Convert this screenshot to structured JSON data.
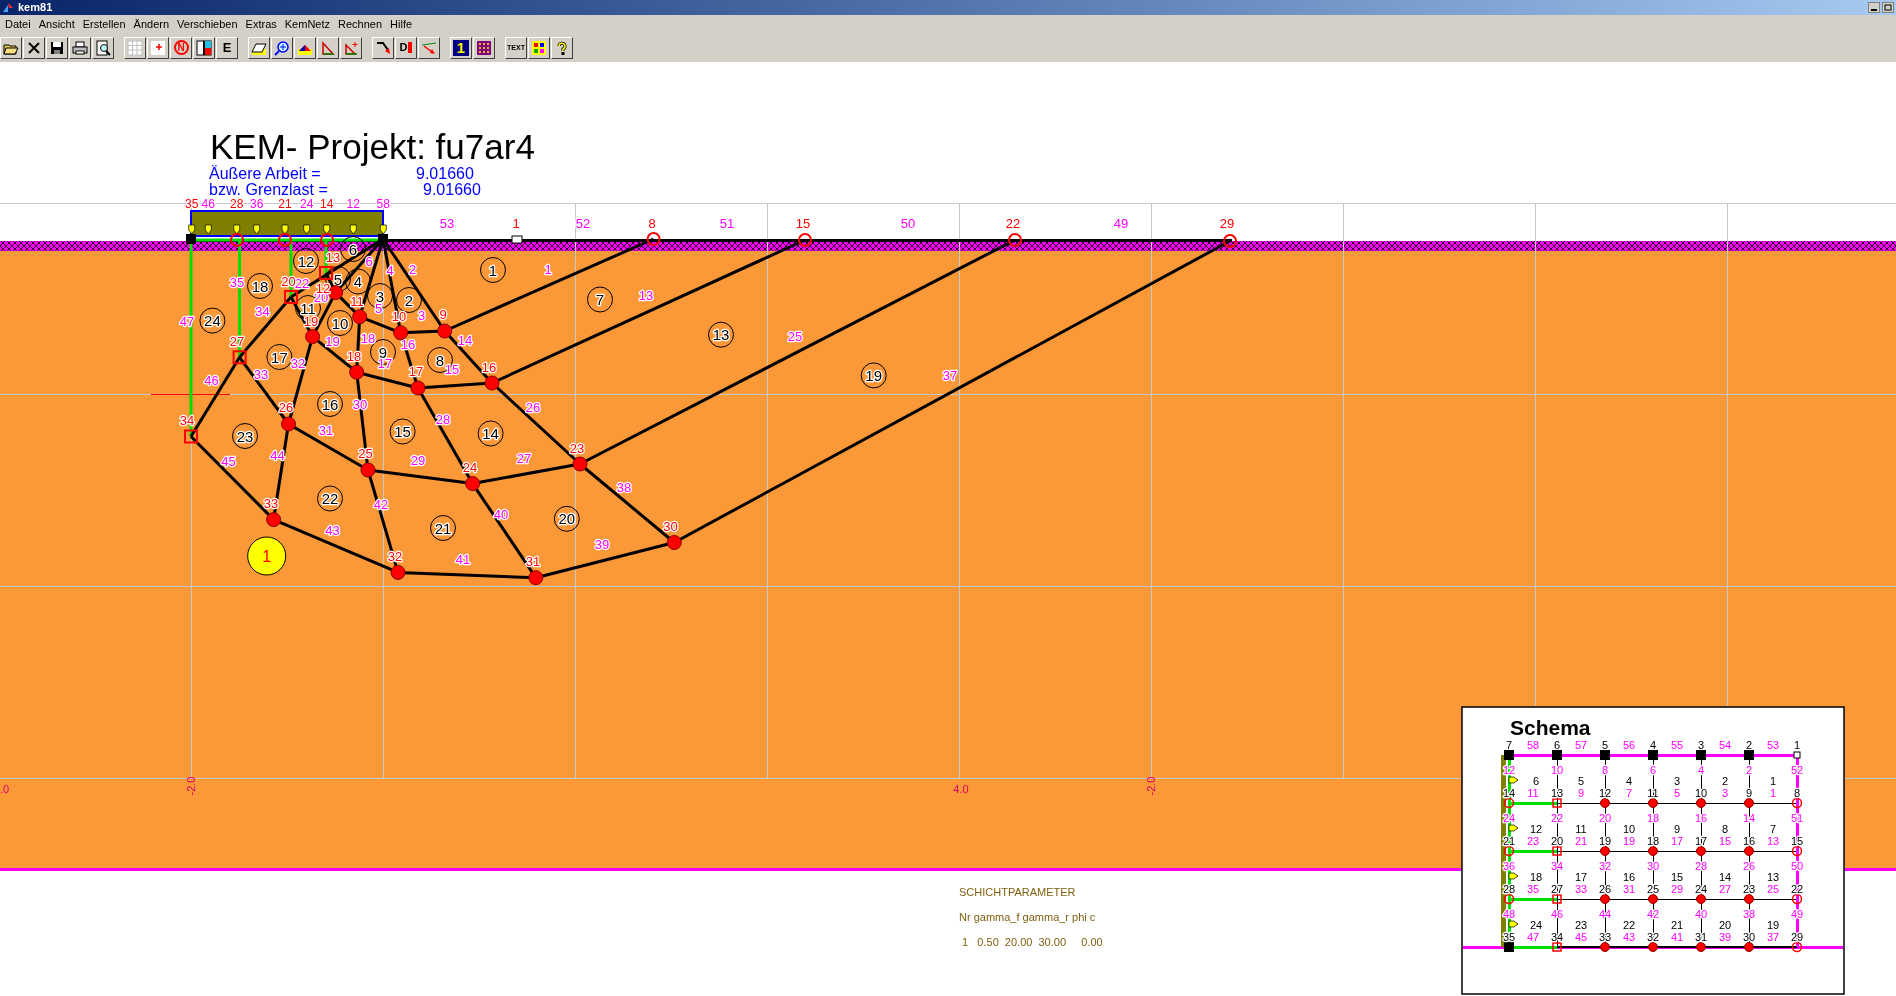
{
  "window": {
    "title": "kem81"
  },
  "menu": [
    "Datei",
    "Ansicht",
    "Erstellen",
    "Ändern",
    "Verschieben",
    "Extras",
    "KemNetz",
    "Rechnen",
    "Hilfe"
  ],
  "toolbar": [
    {
      "kind": "open"
    },
    {
      "kind": "close"
    },
    {
      "kind": "save"
    },
    {
      "kind": "print"
    },
    {
      "kind": "preview"
    },
    {
      "kind": "separator"
    },
    {
      "kind": "grid"
    },
    {
      "kind": "point"
    },
    {
      "kind": "no-sign",
      "label": "N"
    },
    {
      "kind": "split"
    },
    {
      "kind": "letter",
      "label": "E"
    },
    {
      "kind": "separator"
    },
    {
      "kind": "parallelogram"
    },
    {
      "kind": "zoom"
    },
    {
      "kind": "wedge"
    },
    {
      "kind": "triangle"
    },
    {
      "kind": "triangle-star"
    },
    {
      "kind": "separator"
    },
    {
      "kind": "arrow"
    },
    {
      "kind": "d-node",
      "label": "D"
    },
    {
      "kind": "line-arrow"
    },
    {
      "kind": "separator"
    },
    {
      "kind": "number",
      "label": "1"
    },
    {
      "kind": "dots"
    },
    {
      "kind": "separator"
    },
    {
      "kind": "text-tool",
      "label": "TEXT"
    },
    {
      "kind": "palette"
    },
    {
      "kind": "help"
    }
  ],
  "project_title": "KEM- Projekt: fu7ar4",
  "results": [
    {
      "label": "Äußere Arbeit =",
      "value": "9.01660"
    },
    {
      "label": "bzw. Grenzlast =",
      "value": "9.01660"
    }
  ],
  "mesh": {
    "nodes": [
      {
        "kind": "corner"
      },
      {
        "kind": "corner"
      },
      {
        "kind": "ring"
      },
      {
        "kind": "ring"
      },
      {
        "kind": "ring"
      },
      {
        "kind": "small-square",
        "label": "1"
      },
      {
        "kind": "ring",
        "label": "8"
      },
      {
        "kind": "ring",
        "label": "15"
      },
      {
        "kind": "ring",
        "label": "22"
      },
      {
        "kind": "ring",
        "label": "29"
      },
      {
        "kind": "square",
        "label": "13"
      },
      {
        "kind": "square",
        "label": "20"
      },
      {
        "kind": "dot",
        "label": "12"
      },
      {
        "kind": "dot",
        "label": "11"
      },
      {
        "kind": "dot",
        "label": "19"
      },
      {
        "kind": "dot",
        "label": "10"
      },
      {
        "kind": "dot",
        "label": "9"
      },
      {
        "kind": "square",
        "label": "27"
      },
      {
        "kind": "dot",
        "label": "18"
      },
      {
        "kind": "dot",
        "label": "17"
      },
      {
        "kind": "dot",
        "label": "16"
      },
      {
        "kind": "dot",
        "label": "26"
      },
      {
        "kind": "square",
        "label": "34"
      },
      {
        "kind": "dot",
        "label": "25"
      },
      {
        "kind": "dot",
        "label": "23"
      },
      {
        "kind": "dot",
        "label": "24"
      },
      {
        "kind": "dot",
        "label": "33"
      },
      {
        "kind": "dot",
        "label": "30"
      },
      {
        "kind": "dot",
        "label": "32"
      },
      {
        "kind": "dot",
        "label": "31"
      }
    ],
    "elements": [
      "12",
      "6",
      "5",
      "1",
      "18",
      "11",
      "4",
      "3",
      "2",
      "7",
      "24",
      "10",
      "13",
      "17",
      "9",
      "8",
      "19",
      "16",
      "23",
      "15",
      "14",
      "22",
      "21",
      "20"
    ],
    "edge_labels": [
      "53",
      "52",
      "51",
      "50",
      "49",
      "22",
      "6",
      "4",
      "2",
      "1",
      "35",
      "20",
      "13",
      "47",
      "34",
      "5",
      "3",
      "19",
      "18",
      "16",
      "14",
      "25",
      "46",
      "33",
      "32",
      "17",
      "15",
      "37",
      "31",
      "30",
      "28",
      "26",
      "45",
      "44",
      "29",
      "27",
      "38",
      "42",
      "40",
      "43",
      "41",
      "39"
    ],
    "load_labels": [
      {
        "text": "35",
        "kind": "node"
      },
      {
        "text": "46",
        "kind": "edge"
      },
      {
        "text": "28",
        "kind": "node"
      },
      {
        "text": "36",
        "kind": "edge"
      },
      {
        "text": "21",
        "kind": "node"
      },
      {
        "text": "24",
        "kind": "edge"
      },
      {
        "text": "14",
        "kind": "node"
      },
      {
        "text": "12",
        "kind": "edge"
      },
      {
        "text": "58",
        "kind": "edge"
      }
    ]
  },
  "layer_marker": "1",
  "axis_labels": [
    ".0",
    "-2.0",
    "4.0",
    "-2.0"
  ],
  "schema": {
    "title": "Schema",
    "top_nodes": [
      {
        "label": "7",
        "kind": "corner"
      },
      {
        "label": "6",
        "kind": "corner"
      },
      {
        "label": "5",
        "kind": "corner"
      },
      {
        "label": "4",
        "kind": "corner"
      },
      {
        "label": "3",
        "kind": "corner"
      },
      {
        "label": "2",
        "kind": "corner"
      },
      {
        "label": "1",
        "kind": "small-square"
      }
    ],
    "top_edges": [
      "58",
      "57",
      "56",
      "55",
      "54",
      "53"
    ],
    "rows": [
      {
        "links": [
          "12",
          "10",
          "8",
          "6",
          "4",
          "2",
          "52"
        ],
        "elements": [
          "6",
          "5",
          "4",
          "3",
          "2",
          "1"
        ],
        "edges": [
          "11",
          "9",
          "7",
          "5",
          "3",
          "1"
        ],
        "nodes": [
          {
            "label": "14",
            "kind": "ring"
          },
          {
            "label": "13",
            "kind": "square"
          },
          {
            "label": "12",
            "kind": "dot"
          },
          {
            "label": "11",
            "kind": "dot"
          },
          {
            "label": "10",
            "kind": "dot"
          },
          {
            "label": "9",
            "kind": "dot"
          },
          {
            "label": "8",
            "kind": "ring"
          }
        ]
      },
      {
        "links": [
          "24",
          "22",
          "20",
          "18",
          "16",
          "14",
          "51"
        ],
        "elements": [
          "12",
          "11",
          "10",
          "9",
          "8",
          "7"
        ],
        "edges": [
          "23",
          "21",
          "19",
          "17",
          "15",
          "13"
        ],
        "nodes": [
          {
            "label": "21",
            "kind": "ring"
          },
          {
            "label": "20",
            "kind": "square"
          },
          {
            "label": "19",
            "kind": "dot"
          },
          {
            "label": "18",
            "kind": "dot"
          },
          {
            "label": "17",
            "kind": "dot"
          },
          {
            "label": "16",
            "kind": "dot"
          },
          {
            "label": "15",
            "kind": "ring"
          }
        ]
      },
      {
        "links": [
          "36",
          "34",
          "32",
          "30",
          "28",
          "26",
          "50"
        ],
        "elements": [
          "18",
          "17",
          "16",
          "15",
          "14",
          "13"
        ],
        "edges": [
          "35",
          "33",
          "31",
          "29",
          "27",
          "25"
        ],
        "nodes": [
          {
            "label": "28",
            "kind": "ring"
          },
          {
            "label": "27",
            "kind": "square"
          },
          {
            "label": "26",
            "kind": "dot"
          },
          {
            "label": "25",
            "kind": "dot"
          },
          {
            "label": "24",
            "kind": "dot"
          },
          {
            "label": "23",
            "kind": "dot"
          },
          {
            "label": "22",
            "kind": "ring"
          }
        ]
      },
      {
        "links": [
          "48",
          "46",
          "44",
          "42",
          "40",
          "38",
          "49"
        ],
        "elements": [
          "24",
          "23",
          "22",
          "21",
          "20",
          "19"
        ],
        "edges": [
          "47",
          "45",
          "43",
          "41",
          "39",
          "37"
        ],
        "nodes": [
          {
            "label": "35",
            "kind": "corner"
          },
          {
            "label": "34",
            "kind": "square"
          },
          {
            "label": "33",
            "kind": "dot"
          },
          {
            "label": "32",
            "kind": "dot"
          },
          {
            "label": "31",
            "kind": "dot"
          },
          {
            "label": "30",
            "kind": "dot"
          },
          {
            "label": "29",
            "kind": "ring"
          }
        ]
      }
    ]
  },
  "layer_parameters": {
    "title": "SCHICHTPARAMETER",
    "header": "Nr gamma_f gamma_r phi c",
    "rows": [
      " 1   0.50  20.00  30.00     0.00"
    ]
  }
}
